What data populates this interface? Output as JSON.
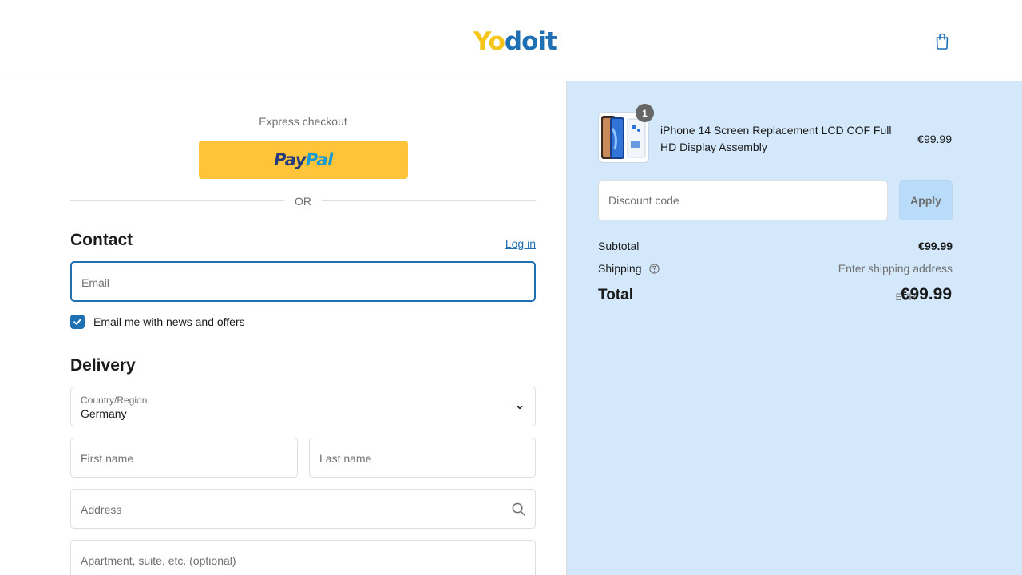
{
  "header": {
    "logo_first": "Yo",
    "logo_rest": "doit",
    "cart_icon": "shopping-bag-icon"
  },
  "express": {
    "label": "Express checkout",
    "paypal_pay": "Pay",
    "paypal_pal": "Pal",
    "or": "OR"
  },
  "contact": {
    "title": "Contact",
    "login": "Log in",
    "email_placeholder": "Email",
    "news_label": "Email me with news and offers",
    "news_checked": true
  },
  "delivery": {
    "title": "Delivery",
    "country_label": "Country/Region",
    "country_value": "Germany",
    "first_name_placeholder": "First name",
    "last_name_placeholder": "Last name",
    "address_placeholder": "Address",
    "apartment_placeholder": "Apartment, suite, etc. (optional)"
  },
  "order": {
    "quantity": "1",
    "product_name": "iPhone 14 Screen Replacement LCD COF Full HD Display Assembly",
    "product_price": "€99.99",
    "discount_placeholder": "Discount code",
    "apply": "Apply",
    "subtotal_label": "Subtotal",
    "subtotal_value": "€99.99",
    "shipping_label": "Shipping",
    "shipping_value": "Enter shipping address",
    "total_label": "Total",
    "currency": "EUR",
    "total_value": "€99.99"
  },
  "colors": {
    "accent": "#1f6fb3",
    "sidebar_bg": "#d4e8fb",
    "paypal_yellow": "#ffc439",
    "logo_yellow": "#f5c518"
  }
}
